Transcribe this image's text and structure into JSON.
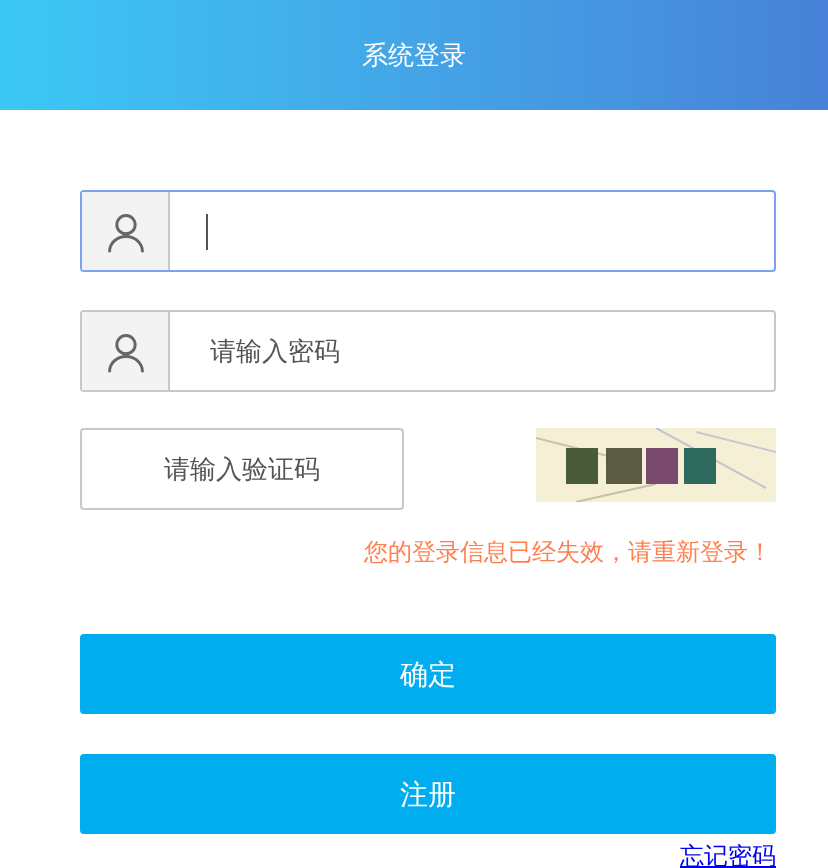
{
  "header": {
    "title": "系统登录"
  },
  "fields": [
    {
      "kind": "icon",
      "focused": true
    },
    {
      "kind": "icon",
      "placeholder": "请输入密码",
      "focused": false
    }
  ],
  "captcha": {
    "placeholder": "请输入验证码"
  },
  "error": "您的登录信息已经失效，请重新登录！",
  "buttons": [
    "确定",
    "注册"
  ],
  "link": "忘记密码"
}
